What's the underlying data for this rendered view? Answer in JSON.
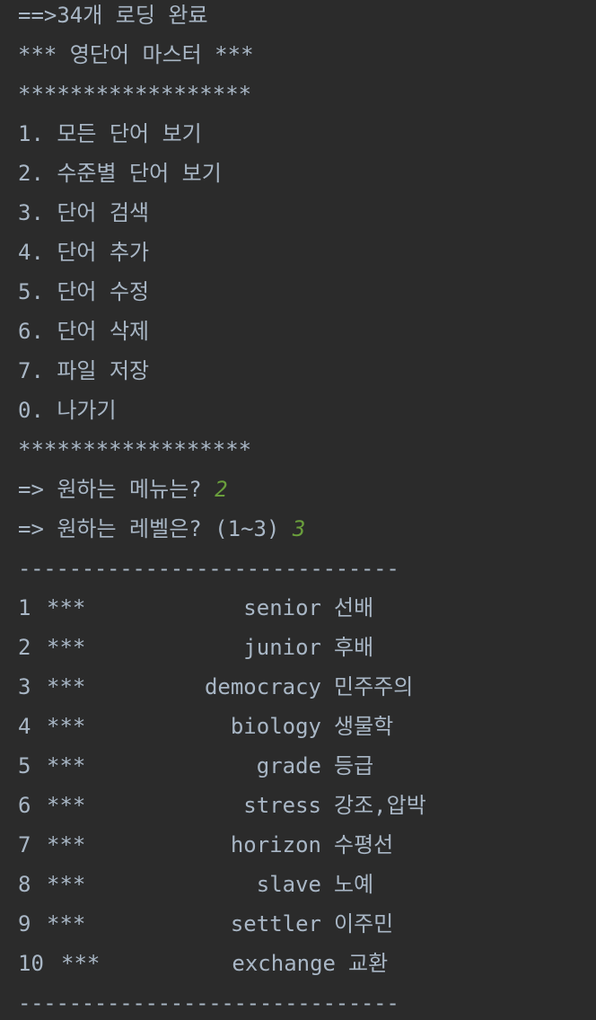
{
  "console": {
    "loading_line": "==>34개 로딩 완료",
    "title_line": "*** 영단어 마스터 ***",
    "stars_line": "******************",
    "menu_items": [
      "1. 모든 단어 보기",
      "2. 수준별 단어 보기",
      "3. 단어 검색",
      "4. 단어 추가",
      "5. 단어 수정",
      "6. 단어 삭제",
      "7. 파일 저장",
      "0. 나가기"
    ],
    "prompt_menu": "=> 원하는 메뉴는? ",
    "prompt_menu_input": "2",
    "prompt_level": "=> 원하는 레벨은? (1~3) ",
    "prompt_level_input": "3",
    "separator": "------------------------------",
    "words": [
      {
        "num": "1",
        "level": "***",
        "word": "senior",
        "meaning": "선배"
      },
      {
        "num": "2",
        "level": "***",
        "word": "junior",
        "meaning": "후배"
      },
      {
        "num": "3",
        "level": "***",
        "word": "democracy",
        "meaning": "민주주의"
      },
      {
        "num": "4",
        "level": "***",
        "word": "biology",
        "meaning": "생물학"
      },
      {
        "num": "5",
        "level": "***",
        "word": "grade",
        "meaning": "등급"
      },
      {
        "num": "6",
        "level": "***",
        "word": "stress",
        "meaning": "강조,압박"
      },
      {
        "num": "7",
        "level": "***",
        "word": "horizon",
        "meaning": "수평선"
      },
      {
        "num": "8",
        "level": "***",
        "word": "slave",
        "meaning": "노예"
      },
      {
        "num": "9",
        "level": "***",
        "word": "settler",
        "meaning": "이주민"
      },
      {
        "num": "10",
        "level": "***",
        "word": "exchange",
        "meaning": "교환"
      }
    ],
    "colors": {
      "background": "#2b2b2b",
      "text": "#a9b7c6",
      "user_input": "#6a9f3c"
    }
  }
}
